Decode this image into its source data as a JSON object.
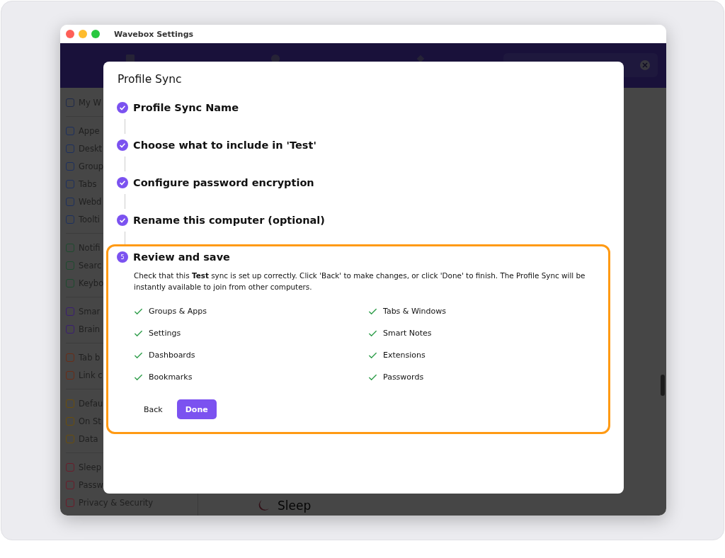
{
  "window": {
    "title": "Wavebox Settings"
  },
  "sidebar": {
    "groups": [
      {
        "items": [
          {
            "label": "My W",
            "color": "#1e2a4a"
          }
        ]
      },
      {
        "items": [
          {
            "label": "Appe",
            "color": "#1c2f5e"
          },
          {
            "label": "Deskt",
            "color": "#1c2f5e"
          },
          {
            "label": "Group",
            "color": "#1c2f5e"
          },
          {
            "label": "Tabs",
            "color": "#1c2f5e"
          },
          {
            "label": "Webd",
            "color": "#1c2f5e"
          },
          {
            "label": "Toolti",
            "color": "#1c2f5e"
          }
        ]
      },
      {
        "items": [
          {
            "label": "Notifi",
            "color": "#1d4a2e"
          },
          {
            "label": "Searc",
            "color": "#1d4a2e"
          },
          {
            "label": "Keybo",
            "color": "#1d4a2e"
          }
        ]
      },
      {
        "items": [
          {
            "label": "Smar",
            "color": "#3a1d72"
          },
          {
            "label": "Brain",
            "color": "#3a1d72"
          }
        ]
      },
      {
        "items": [
          {
            "label": "Tab b",
            "color": "#6a2c16"
          },
          {
            "label": "Link c",
            "color": "#6a2c16"
          }
        ]
      },
      {
        "items": [
          {
            "label": "Defau",
            "color": "#6a4e0c"
          },
          {
            "label": "On St",
            "color": "#6a4e0c"
          },
          {
            "label": "Data",
            "color": "#6a4e0c"
          }
        ]
      },
      {
        "items": [
          {
            "label": "Sleep",
            "color": "#6a1c2a"
          },
          {
            "label": "Passw",
            "color": "#6a1c2a"
          },
          {
            "label": "Privacy & Security",
            "color": "#6a1c2a"
          }
        ]
      }
    ]
  },
  "content": {
    "heading": "Sleep"
  },
  "dialog": {
    "title": "Profile Sync",
    "steps": [
      {
        "title": "Profile Sync Name",
        "completed": true
      },
      {
        "title": "Choose what to include in 'Test'",
        "completed": true
      },
      {
        "title": "Configure password encryption",
        "completed": true
      },
      {
        "title": "Rename this computer (optional)",
        "completed": true
      },
      {
        "title": "Review and save",
        "number": "5",
        "completed": false,
        "highlighted": true,
        "description": "Check that this **Test** sync is set up correctly. Click 'Back' to make changes, or click 'Done' to finish. The Profile Sync will be instantly available to join from other computers.",
        "items": [
          {
            "label": "Groups & Apps",
            "checked": true
          },
          {
            "label": "Tabs & Windows",
            "checked": true
          },
          {
            "label": "Settings",
            "checked": true
          },
          {
            "label": "Smart Notes",
            "checked": true
          },
          {
            "label": "Dashboards",
            "checked": true
          },
          {
            "label": "Extensions",
            "checked": true
          },
          {
            "label": "Bookmarks",
            "checked": true
          },
          {
            "label": "Passwords",
            "checked": true
          }
        ],
        "buttons": [
          {
            "label": "Back",
            "kind": "text"
          },
          {
            "label": "Done",
            "kind": "primary"
          }
        ]
      }
    ]
  }
}
